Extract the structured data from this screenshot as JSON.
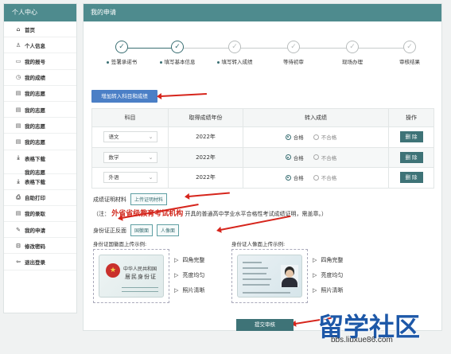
{
  "sidebar": {
    "title": "个人中心",
    "items": [
      {
        "icon": "home-icon",
        "glyph": "⌂",
        "label": "首页"
      },
      {
        "icon": "user-icon",
        "glyph": "♙",
        "label": "个人信息"
      },
      {
        "icon": "card-icon",
        "glyph": "▭",
        "label": "我的报号"
      },
      {
        "icon": "clock-icon",
        "glyph": "◷",
        "label": "我的成绩"
      },
      {
        "icon": "doc-icon",
        "glyph": "▤",
        "label": "我的志愿"
      },
      {
        "icon": "doc-icon",
        "glyph": "▤",
        "label": "我的志愿"
      },
      {
        "icon": "doc-icon",
        "glyph": "▤",
        "label": "我的志愿"
      },
      {
        "icon": "doc-icon",
        "glyph": "▤",
        "label": "我的志愿"
      },
      {
        "icon": "download-icon",
        "glyph": "⤓",
        "label": "表格下载",
        "label2": "我的志愿"
      },
      {
        "icon": "download-icon",
        "glyph": "⤓",
        "label": "表格下载"
      },
      {
        "icon": "print-icon",
        "glyph": "⎙",
        "label": "自助打印"
      },
      {
        "icon": "admission-icon",
        "glyph": "▤",
        "label": "我的录取"
      },
      {
        "icon": "edit-icon",
        "glyph": "✎",
        "label": "我的申请"
      },
      {
        "icon": "lock-icon",
        "glyph": "⊟",
        "label": "修改密码"
      },
      {
        "icon": "logout-icon",
        "glyph": "⇦",
        "label": "退出登录"
      }
    ]
  },
  "main": {
    "title": "我的申请",
    "steps": [
      {
        "label": "签署承诺书",
        "done": true,
        "dot": true
      },
      {
        "label": "填写基本信息",
        "done": true,
        "dot": true
      },
      {
        "label": "填写转入成绩",
        "done": false,
        "dot": true
      },
      {
        "label": "等待初审",
        "done": false,
        "dot": false
      },
      {
        "label": "现场办理",
        "done": false,
        "dot": false
      },
      {
        "label": "审核结果",
        "done": false,
        "dot": false
      }
    ],
    "add_button": "增加转入科目和成绩",
    "table": {
      "headers": [
        "科目",
        "取得成绩年份",
        "转入成绩",
        "操作"
      ],
      "rows": [
        {
          "subject": "语文",
          "year": "2022年",
          "pass": "合格",
          "fail": "不合格",
          "action": "删 除"
        },
        {
          "subject": "数学",
          "year": "2022年",
          "pass": "合格",
          "fail": "不合格",
          "action": "删 除"
        },
        {
          "subject": "外语",
          "year": "2022年",
          "pass": "合格",
          "fail": "不合格",
          "action": "删 除"
        }
      ]
    },
    "cert": {
      "label": "成绩证明材料",
      "upload_button": "上传证明材料",
      "note_prefix": "（注：",
      "note_red": "外省省级教育考试机构",
      "note_suffix": "开具的普通高中学业水平合格性考试成绩证明，需盖章。）"
    },
    "id": {
      "label": "身份证正反面",
      "btn_front": "国徽面",
      "btn_back": "人像面",
      "example_front_title": "身份证国徽面上传示例:",
      "example_back_title": "身份证人像面上传示例:",
      "card_text_1": "中华人民共和国",
      "card_text_2": "居民身份证",
      "checks": [
        "四角完整",
        "亮度均匀",
        "照片清晰"
      ]
    },
    "submit": "提交审核"
  },
  "watermark": {
    "text": "留学社区",
    "url": "bbs.liuxue86.com"
  }
}
